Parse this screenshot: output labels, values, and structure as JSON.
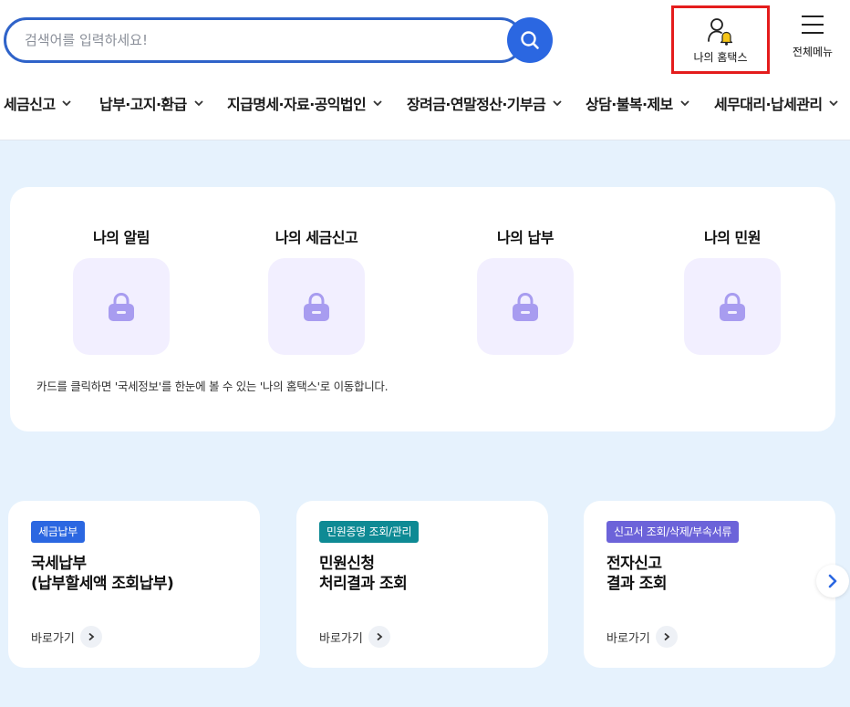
{
  "search": {
    "placeholder": "검색어를 입력하세요!",
    "button_icon": "search-icon"
  },
  "header": {
    "my_hometax_label": "나의 홈택스",
    "all_menu_label": "전체메뉴",
    "highlight_color": "#e41c1c"
  },
  "nav": {
    "items": [
      {
        "label": "세금신고"
      },
      {
        "label": "납부·고지·환급"
      },
      {
        "label": "지급명세·자료·공익법인"
      },
      {
        "label": "장려금·연말정산·기부금"
      },
      {
        "label": "상담·불복·제보"
      },
      {
        "label": "세무대리·납세관리"
      }
    ]
  },
  "summary": {
    "items": [
      {
        "title": "나의 알림",
        "icon": "lock-icon"
      },
      {
        "title": "나의 세금신고",
        "icon": "lock-icon"
      },
      {
        "title": "나의 납부",
        "icon": "lock-icon"
      },
      {
        "title": "나의 민원",
        "icon": "lock-icon"
      }
    ],
    "note": "카드를 클릭하면 '국세정보'를 한눈에 볼 수 있는 '나의 홈택스'로 이동합니다."
  },
  "cards": [
    {
      "badge": "세금납부",
      "badge_color": "#2b67e1",
      "title_line1": "국세납부",
      "title_line2": "(납부할세액 조회납부)",
      "link": "바로가기"
    },
    {
      "badge": "민원증명 조회/관리",
      "badge_color": "#0e8a94",
      "title_line1": "민원신청",
      "title_line2": "처리결과 조회",
      "link": "바로가기"
    },
    {
      "badge": "신고서 조회/삭제/부속서류",
      "badge_color": "#6c63d9",
      "title_line1": "전자신고",
      "title_line2": "결과 조회",
      "link": "바로가기"
    }
  ],
  "colors": {
    "primary": "#2b67e1",
    "page_background": "#e6f2fd",
    "lock_tile": "#f2efff",
    "lock_icon": "#a89cf0",
    "bell": "#f5c518"
  }
}
